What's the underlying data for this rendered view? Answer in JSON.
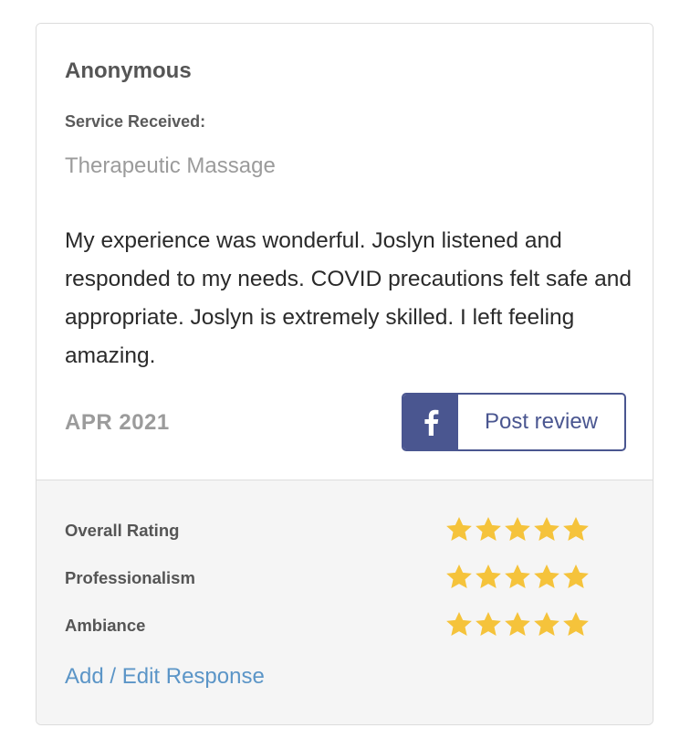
{
  "review": {
    "author": "Anonymous",
    "service_label": "Service Received:",
    "service_name": "Therapeutic Massage",
    "text": "My experience was wonderful. Joslyn listened and responded to my needs. COVID precautions felt safe and appropriate. Joslyn is extremely skilled. I left feeling amazing.",
    "date": "APR 2021"
  },
  "share": {
    "icon": "facebook-icon",
    "label": "Post review",
    "color": "#4a5690"
  },
  "ratings": [
    {
      "label": "Overall Rating",
      "stars": 5,
      "max": 5
    },
    {
      "label": "Professionalism",
      "stars": 5,
      "max": 5
    },
    {
      "label": "Ambiance",
      "stars": 5,
      "max": 5
    }
  ],
  "star_color": "#f5c33b",
  "response_link": "Add / Edit Response",
  "link_color": "#5b95c7"
}
